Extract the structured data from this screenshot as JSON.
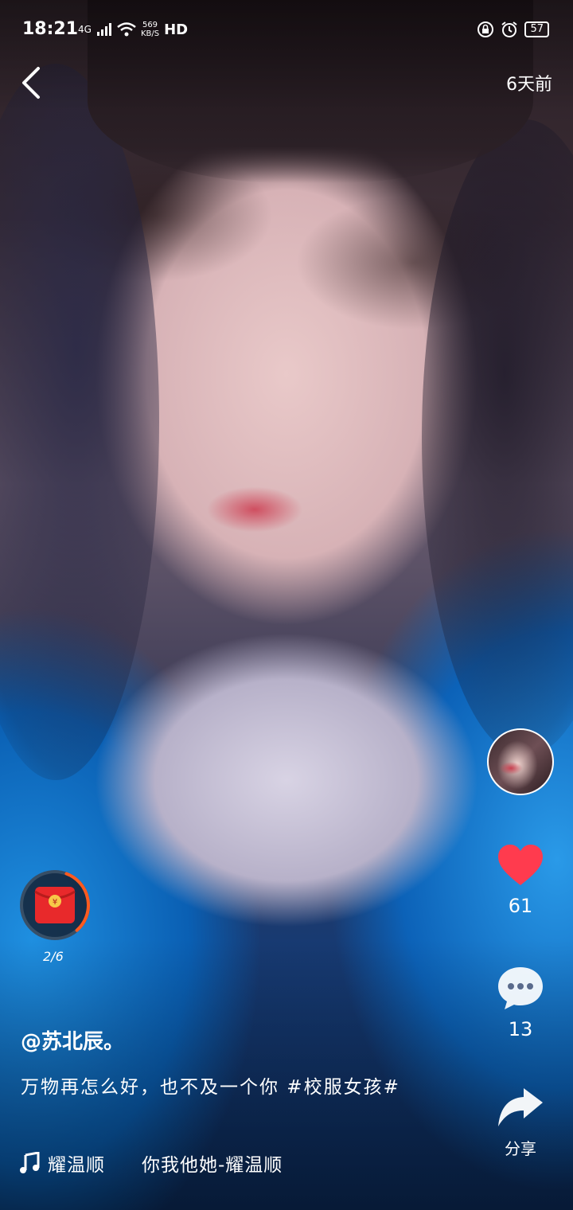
{
  "status_bar": {
    "time": "18:21",
    "network": "4G",
    "speed_value": "569",
    "speed_unit": "KB/S",
    "hd": "HD",
    "battery": "57"
  },
  "header": {
    "post_time": "6天前"
  },
  "redpack": {
    "progress_label": "2/6",
    "progress_fraction": 0.33
  },
  "actions": {
    "likes": "61",
    "comments": "13",
    "share_label": "分享"
  },
  "caption": {
    "author": "@苏北辰。",
    "description": "万物再怎么好，也不及一个你 #校服女孩#"
  },
  "music": {
    "title": "耀温顺",
    "song": "你我他她-耀温顺"
  },
  "colors": {
    "like_red": "#ff3b4e",
    "redpack_red": "#e8292b",
    "ring_orange": "#ff5a1f"
  }
}
